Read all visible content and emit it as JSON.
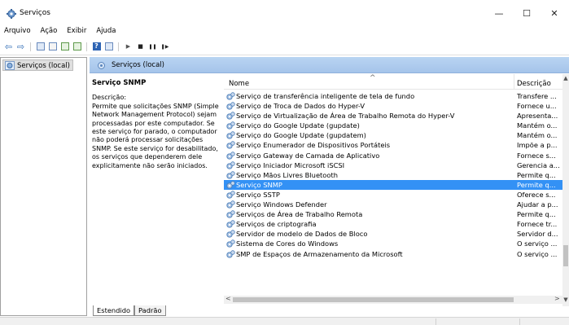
{
  "window": {
    "title": "Serviços",
    "controls": {
      "minimize": "—",
      "maximize": "☐",
      "close": "✕"
    }
  },
  "menu": [
    "Arquivo",
    "Ação",
    "Exibir",
    "Ajuda"
  ],
  "toolbar": {
    "icons": [
      "back-icon",
      "forward-icon",
      "console-tree-icon",
      "properties-icon",
      "refresh-icon",
      "export-icon",
      "help-icon",
      "view-icon",
      "start-icon",
      "stop-icon",
      "pause-icon",
      "restart-icon"
    ],
    "glyphs": {
      "back": "⇦",
      "forward": "⇨",
      "help": "?",
      "start": "▶",
      "stop": "■",
      "pause": "❚❚",
      "restart": "❚▶"
    }
  },
  "tree": {
    "item": "Serviços (local)"
  },
  "panel": {
    "header": "Serviços (local)",
    "selected_service": "Serviço SNMP",
    "description_label": "Descrição:",
    "description_text": "Permite que solicitações SNMP (Simple Network Management Protocol) sejam processadas por este computador. Se este serviço for parado, o computador não poderá processar solicitações SNMP. Se este serviço for desabilitado, os serviços que dependerem dele explicitamente não serão iniciados."
  },
  "list": {
    "columns": {
      "name": "Nome",
      "description": "Descrição",
      "sort_indicator": "^"
    },
    "rows": [
      {
        "name": "Serviço de transferência inteligente de tela de fundo",
        "description": "Transfere ..."
      },
      {
        "name": "Serviço de Troca de Dados do Hyper-V",
        "description": "Fornece u..."
      },
      {
        "name": "Serviço de Virtualização de Área de Trabalho Remota do Hyper-V",
        "description": "Apresenta..."
      },
      {
        "name": "Serviço do Google Update (gupdate)",
        "description": "Mantém o..."
      },
      {
        "name": "Serviço do Google Update (gupdatem)",
        "description": "Mantém o..."
      },
      {
        "name": "Serviço Enumerador de Dispositivos Portáteis",
        "description": "Impõe a p..."
      },
      {
        "name": "Serviço Gateway de Camada de Aplicativo",
        "description": "Fornece s..."
      },
      {
        "name": "Serviço Iniciador Microsoft iSCSI",
        "description": "Gerencia a..."
      },
      {
        "name": "Serviço Mãos Livres Bluetooth",
        "description": "Permite q..."
      },
      {
        "name": "Serviço SNMP",
        "description": "Permite q...",
        "selected": true
      },
      {
        "name": "Serviço SSTP",
        "description": "Oferece s..."
      },
      {
        "name": "Serviço Windows Defender",
        "description": "Ajudar a p..."
      },
      {
        "name": "Serviços de Área de Trabalho Remota",
        "description": "Permite q..."
      },
      {
        "name": "Serviços de criptografia",
        "description": "Fornece tr..."
      },
      {
        "name": "Servidor de modelo de Dados de Bloco",
        "description": "Servidor d..."
      },
      {
        "name": "Sistema de Cores do Windows",
        "description": "O serviço ..."
      },
      {
        "name": "SMP de Espaços de Armazenamento da Microsoft",
        "description": "O serviço ..."
      }
    ]
  },
  "tabs": [
    "Estendido",
    "Padrão"
  ],
  "colors": {
    "selection": "#3391f5",
    "panel_header": "#b9d4f2",
    "gear": "#4d7fb8"
  }
}
